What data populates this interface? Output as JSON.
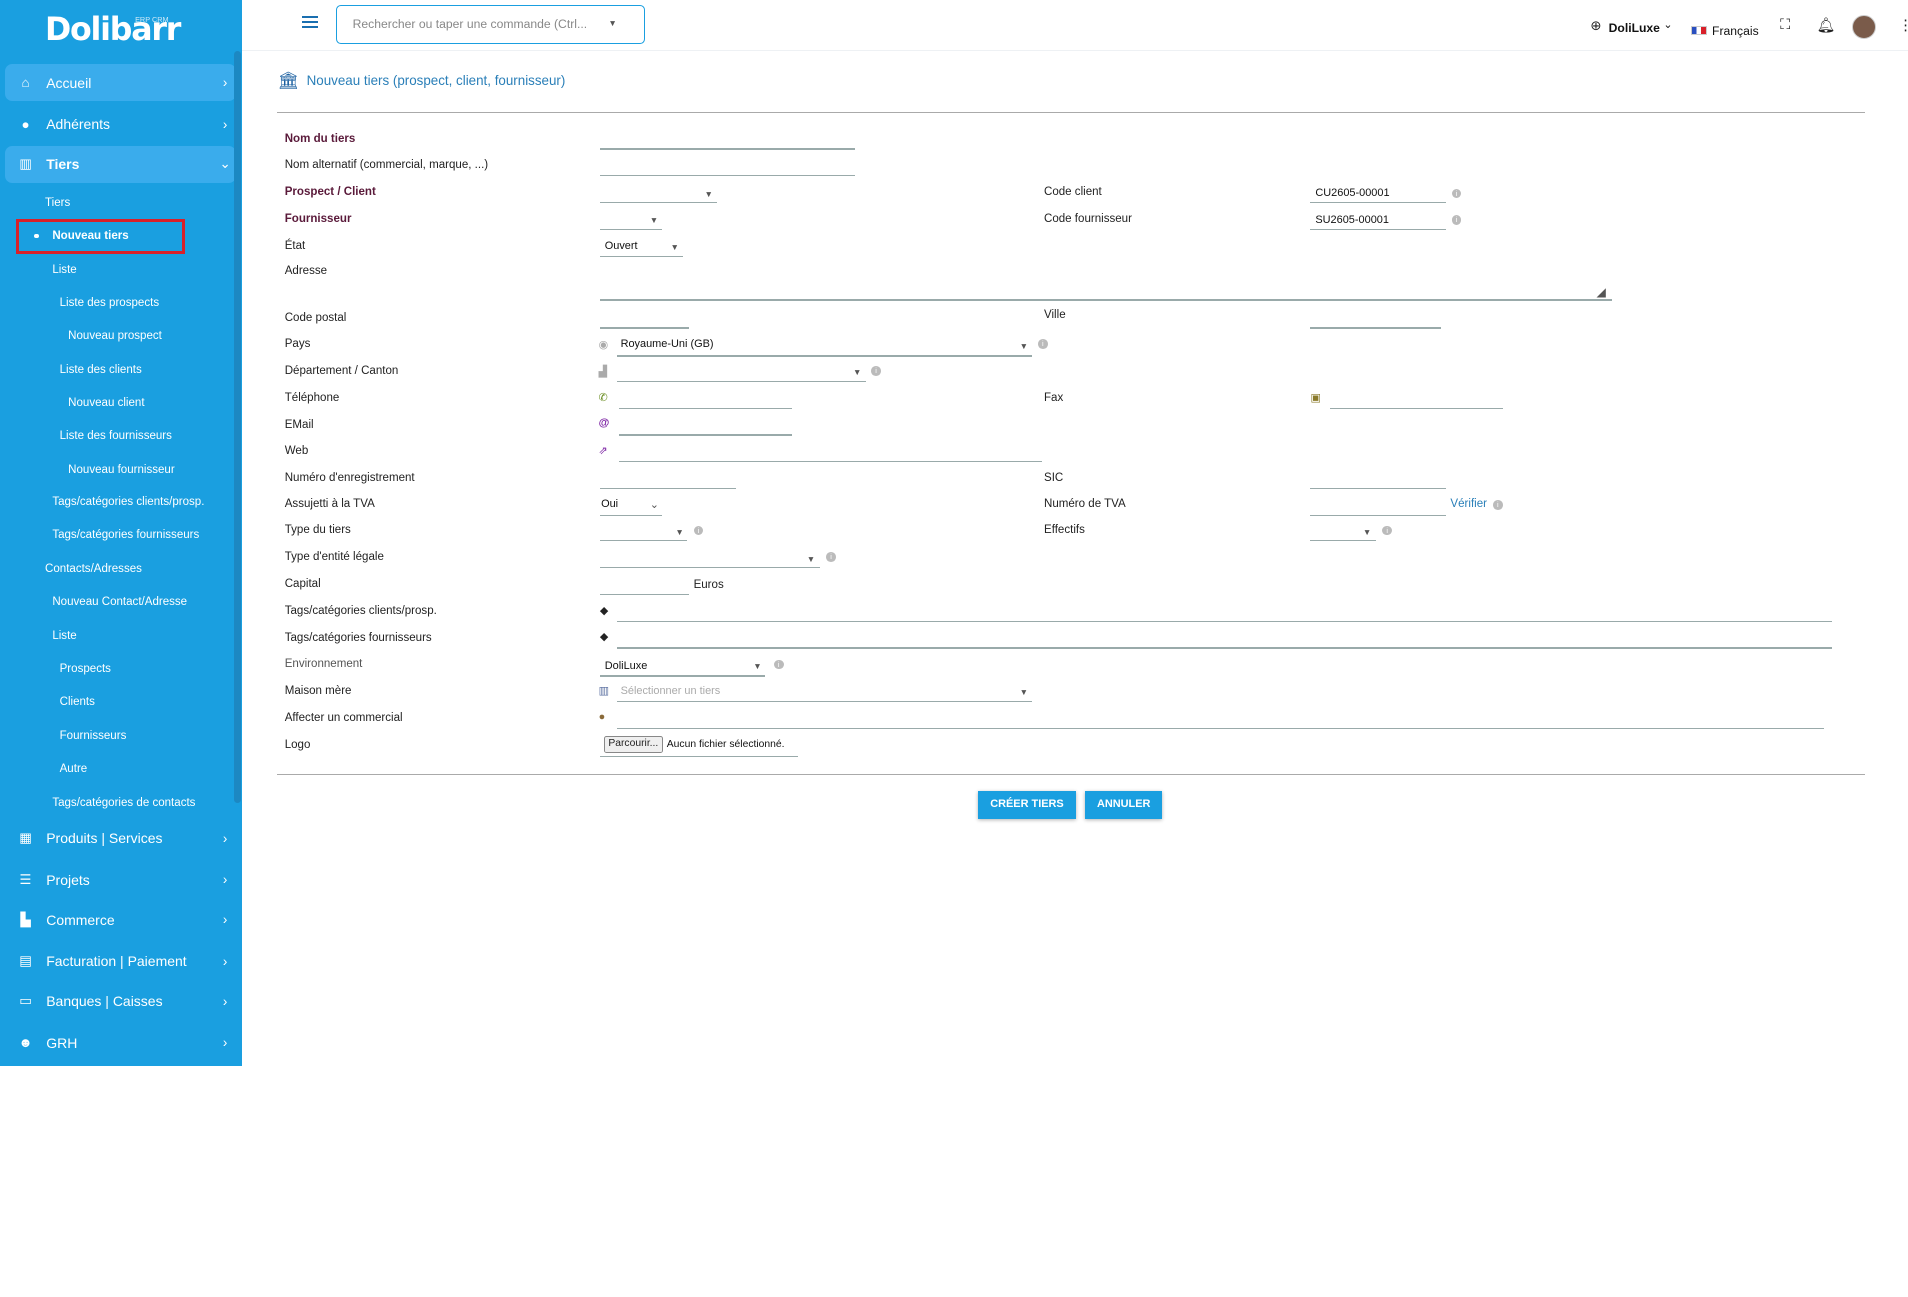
{
  "app": {
    "brand": "Dolibarr",
    "brand_sub": "ERP CRM"
  },
  "topbar": {
    "search_placeholder": "Rechercher ou taper une commande (Ctrl...",
    "company": "DoliLuxe",
    "language": "Français"
  },
  "sidebar": {
    "top_items": [
      {
        "label": "Accueil",
        "icon": "home-icon"
      },
      {
        "label": "Adhérents",
        "icon": "user-icon"
      },
      {
        "label": "Tiers",
        "icon": "building-icon"
      }
    ],
    "sub_items": [
      "Tiers",
      "Nouveau tiers",
      "Liste",
      "Liste des prospects",
      "Nouveau prospect",
      "Liste des clients",
      "Nouveau client",
      "Liste des fournisseurs",
      "Nouveau fournisseur",
      "Tags/catégories clients/prosp.",
      "Tags/catégories fournisseurs",
      "Contacts/Adresses",
      "Nouveau Contact/Adresse",
      "Liste",
      "Prospects",
      "Clients",
      "Fournisseurs",
      "Autre",
      "Tags/catégories de contacts"
    ],
    "bottom_items": [
      {
        "label": "Produits | Services",
        "icon": "cubes-icon"
      },
      {
        "label": "Projets",
        "icon": "tasks-icon"
      },
      {
        "label": "Commerce",
        "icon": "suitcase-icon"
      },
      {
        "label": "Facturation | Paiement",
        "icon": "invoice-icon"
      },
      {
        "label": "Banques | Caisses",
        "icon": "bank-card-icon"
      },
      {
        "label": "GRH",
        "icon": "users-icon"
      }
    ]
  },
  "page": {
    "title": "Nouveau tiers (prospect, client, fournisseur)"
  },
  "form": {
    "labels": {
      "nom": "Nom du tiers",
      "nom_alt": "Nom alternatif (commercial, marque, ...)",
      "prospect_client": "Prospect / Client",
      "fournisseur": "Fournisseur",
      "etat": "État",
      "adresse": "Adresse",
      "code_postal": "Code postal",
      "pays": "Pays",
      "departement": "Département / Canton",
      "telephone": "Téléphone",
      "email": "EMail",
      "web": "Web",
      "num_enreg": "Numéro d'enregistrement",
      "assujetti_tva": "Assujetti à la TVA",
      "type_tiers": "Type du tiers",
      "type_entite": "Type d'entité légale",
      "capital": "Capital",
      "tags_clients": "Tags/catégories clients/prosp.",
      "tags_fournisseurs": "Tags/catégories fournisseurs",
      "environnement": "Environnement",
      "maison_mere": "Maison mère",
      "commercial": "Affecter un commercial",
      "logo": "Logo",
      "code_client": "Code client",
      "code_fournisseur": "Code fournisseur",
      "ville": "Ville",
      "fax": "Fax",
      "sic": "SIC",
      "num_tva": "Numéro de TVA",
      "effectifs": "Effectifs"
    },
    "values": {
      "etat": "Ouvert",
      "pays": "Royaume-Uni (GB)",
      "assujetti_tva": "Oui",
      "capital_unit": "Euros",
      "environnement": "DoliLuxe",
      "maison_mere_placeholder": "Sélectionner un tiers",
      "code_client": "CU2605-00001",
      "code_fournisseur": "SU2605-00001",
      "verifier": "Vérifier",
      "logo_button": "Parcourir...",
      "logo_status": "Aucun fichier sélectionné."
    }
  },
  "buttons": {
    "create": "CRÉER TIERS",
    "cancel": "ANNULER"
  }
}
